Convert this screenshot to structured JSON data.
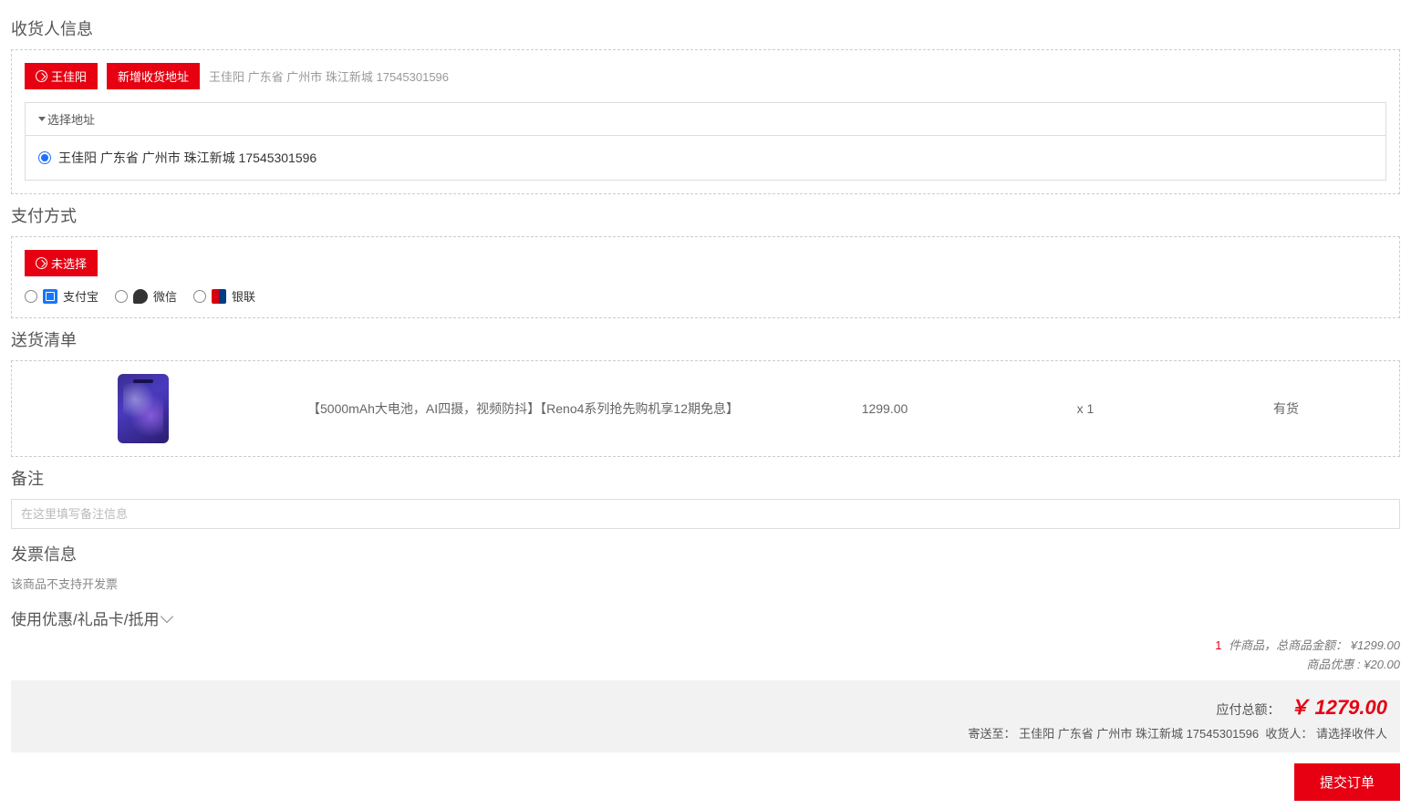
{
  "recipient": {
    "title": "收货人信息",
    "selected_badge": "王佳阳",
    "add_button": "新增收货地址",
    "summary": "王佳阳 广东省 广州市 珠江新城 17545301596",
    "select_label": "选择地址",
    "address_option": "王佳阳 广东省 广州市 珠江新城 17545301596"
  },
  "payment": {
    "title": "支付方式",
    "none_badge": "未选择",
    "options": {
      "alipay": "支付宝",
      "wechat": "微信",
      "union": "银联"
    }
  },
  "shipment": {
    "title": "送货清单",
    "item": {
      "desc": "【5000mAh大电池，AI四摄，视频防抖】【Reno4系列抢先购机享12期免息】",
      "price": "1299.00",
      "qty": "x 1",
      "stock": "有货"
    }
  },
  "remark": {
    "title": "备注",
    "placeholder": "在这里填写备注信息"
  },
  "invoice": {
    "title": "发票信息",
    "note": "该商品不支持开发票"
  },
  "coupon": {
    "title": "使用优惠/礼品卡/抵用"
  },
  "totals": {
    "count": "1",
    "count_suffix": " 件商品，总商品金额：",
    "subtotal": "¥1299.00",
    "discount_label": "商品优惠 :",
    "discount": "¥20.00"
  },
  "footer": {
    "payable_label": "应付总额：",
    "payable": "￥ 1279.00",
    "ship_to_label": "寄送至：",
    "ship_to": "王佳阳 广东省 广州市 珠江新城 17545301596",
    "receiver_label": "收货人：",
    "receiver": "请选择收件人"
  },
  "submit": {
    "label": "提交订单"
  }
}
